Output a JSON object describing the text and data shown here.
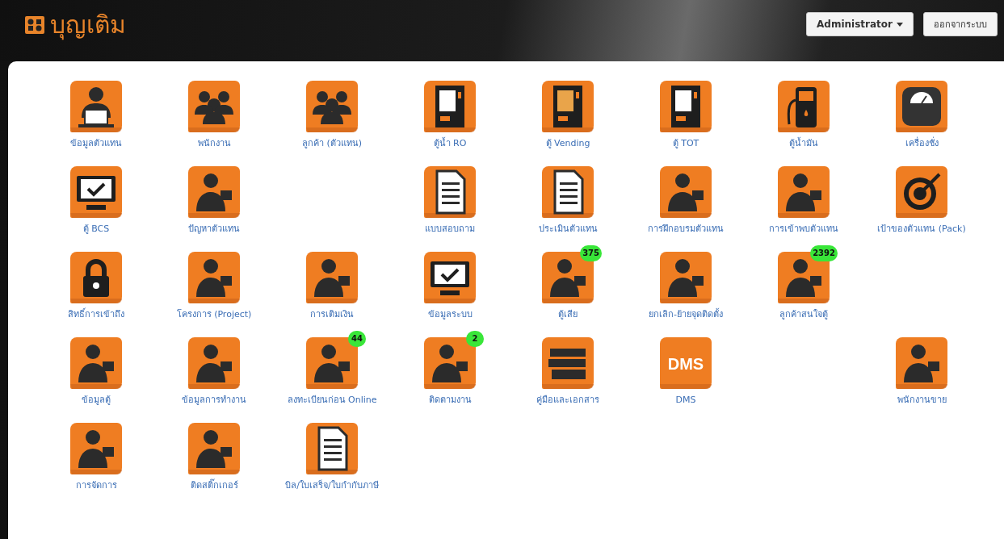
{
  "header": {
    "logo": "บุญเติม",
    "user_menu": "Administrator",
    "logout": "ออกจากระบบ"
  },
  "rows": [
    {
      "tiles": [
        {
          "kind": "app",
          "label": "ข้อมูลตัวแทน"
        },
        {
          "kind": "app",
          "label": "พนักงาน"
        },
        {
          "kind": "app",
          "label": "ลูกค้า (ตัวแทน)"
        },
        {
          "kind": "app",
          "label": "ตู้น้ำ RO"
        },
        {
          "kind": "app",
          "label": "ตู้ Vending"
        },
        {
          "kind": "app",
          "label": "ตู้ TOT"
        },
        {
          "kind": "app",
          "label": "ตู้น้ำมัน"
        },
        {
          "kind": "app",
          "label": "เครื่องชั่ง"
        }
      ]
    },
    {
      "tiles": [
        {
          "kind": "app",
          "label": "ตู้ BCS"
        },
        {
          "kind": "app",
          "label": "ปัญหาตัวแทน"
        },
        {
          "kind": "empty"
        },
        {
          "kind": "app",
          "label": "แบบสอบถาม"
        },
        {
          "kind": "app",
          "label": "ประเมินตัวแทน"
        },
        {
          "kind": "app",
          "label": "การฝึกอบรมตัวแทน"
        },
        {
          "kind": "app",
          "label": "การเข้าพบตัวแทน"
        },
        {
          "kind": "app",
          "label": "เป้าของตัวแทน (Pack)"
        }
      ]
    },
    {
      "tiles": [
        {
          "kind": "app",
          "label": "สิทธิ์การเข้าถึง"
        },
        {
          "kind": "app",
          "label": "โครงการ (Project)"
        },
        {
          "kind": "app",
          "label": "การเติมเงิน"
        },
        {
          "kind": "app",
          "label": "ข้อมูลระบบ"
        },
        {
          "kind": "app",
          "label": "ตู้เสีย",
          "badge": "375"
        },
        {
          "kind": "app",
          "label": "ยกเลิก-ย้ายจุดติดตั้ง"
        },
        {
          "kind": "app",
          "label": "ลูกค้าสนใจตู้",
          "badge": "2392"
        }
      ]
    },
    {
      "tiles": [
        {
          "kind": "app",
          "label": "ข้อมูลตู้"
        },
        {
          "kind": "app",
          "label": "ข้อมูลการทำงาน"
        },
        {
          "kind": "app",
          "label": "ลงทะเบียนก่อน Online",
          "badge": "44"
        },
        {
          "kind": "app",
          "label": "ติดตามงาน",
          "badge": "2"
        },
        {
          "kind": "app",
          "label": "คู่มือและเอกสาร"
        },
        {
          "kind": "app",
          "label": "DMS",
          "icon_text": "DMS"
        },
        {
          "kind": "empty"
        },
        {
          "kind": "app",
          "label": "พนักงานขาย"
        }
      ]
    },
    {
      "tiles": [
        {
          "kind": "app",
          "label": "การจัดการ"
        },
        {
          "kind": "app",
          "label": "ติดสติ๊กเกอร์"
        },
        {
          "kind": "app",
          "label": "บิล/ใบเสร็จ/ใบกำกับภาษี"
        }
      ]
    }
  ]
}
